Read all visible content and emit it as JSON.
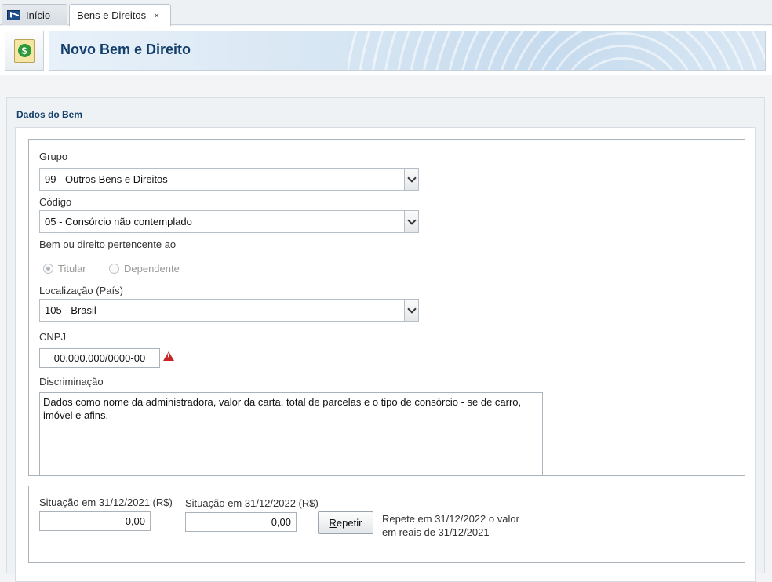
{
  "tabs": {
    "inicio": "Início",
    "bens": "Bens e Direitos",
    "close_glyph": "×"
  },
  "header": {
    "title": "Novo Bem e Direito",
    "icon": "money-document-icon",
    "icon_symbol": "$"
  },
  "section": {
    "title": "Dados do Bem"
  },
  "form": {
    "grupo": {
      "label": "Grupo",
      "value": "99 - Outros Bens e Direitos"
    },
    "codigo": {
      "label": "Código",
      "value": "05 - Consórcio não contemplado"
    },
    "pertencente": {
      "label": "Bem ou direito pertencente ao",
      "options": [
        {
          "label": "Titular",
          "checked": true
        },
        {
          "label": "Dependente",
          "checked": false
        }
      ]
    },
    "localizacao": {
      "label": "Localização (País)",
      "value": "105 - Brasil"
    },
    "cnpj": {
      "label": "CNPJ",
      "value": "00.000.000/0000-00",
      "warning_glyph": "!"
    },
    "discriminacao": {
      "label": "Discriminação",
      "value": "Dados como nome da administradora, valor da carta, total de parcelas e o tipo de consórcio - se de carro, imóvel e afins."
    }
  },
  "situacao": {
    "ano_anterior": {
      "label": "Situação em 31/12/2021 (R$)",
      "value": "0,00"
    },
    "ano_atual": {
      "label": "Situação em 31/12/2022 (R$)",
      "value": "0,00"
    },
    "repetir": {
      "accel": "R",
      "rest": "epetir"
    },
    "note_line1": "Repete em 31/12/2022 o valor",
    "note_line2": "em reais de 31/12/2021"
  },
  "colors": {
    "title_blue": "#143f6b",
    "warning_red": "#c72626"
  }
}
